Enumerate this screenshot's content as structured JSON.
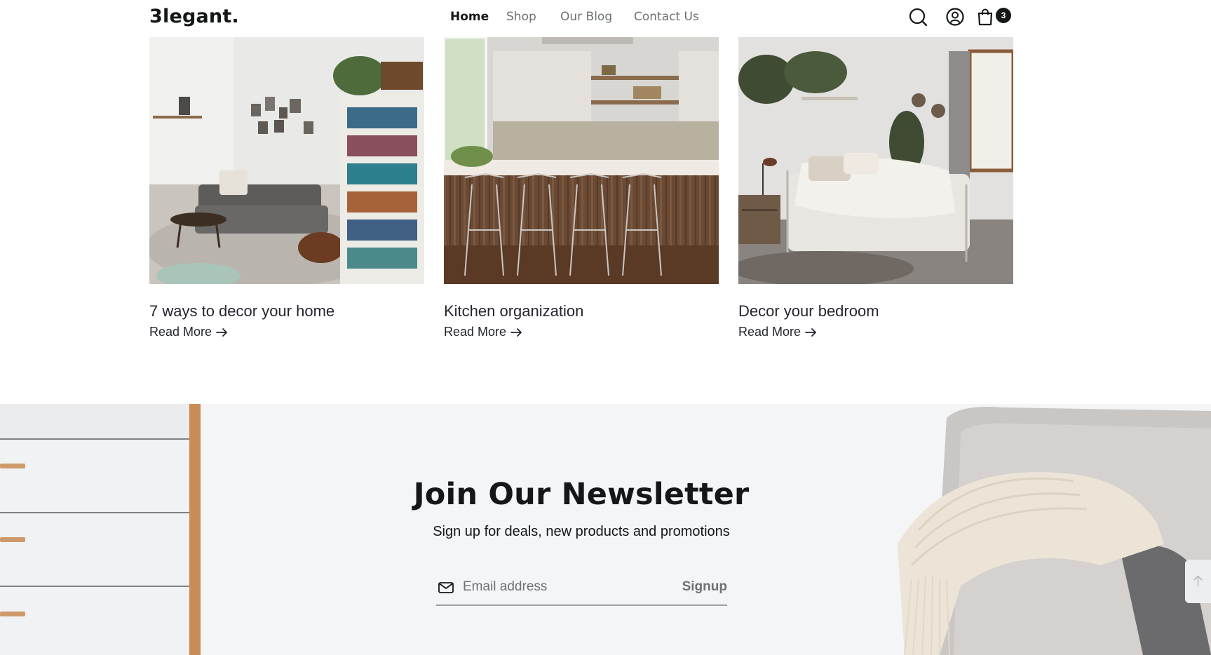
{
  "brand": {
    "logo": "3legant."
  },
  "nav": [
    {
      "label": "Home",
      "active": true
    },
    {
      "label": "Shop",
      "active": false
    },
    {
      "label": "Our Blog",
      "active": false
    },
    {
      "label": "Contact Us",
      "active": false
    }
  ],
  "header_icons": [
    "search-icon",
    "user-icon",
    "shopping-bag-icon"
  ],
  "cart": {
    "count": "3"
  },
  "blog": {
    "posts": [
      {
        "title": "7 ways to decor your home",
        "link_label": "Read More",
        "image": "living-room-photo"
      },
      {
        "title": "Kitchen organization",
        "link_label": "Read More",
        "image": "kitchen-photo"
      },
      {
        "title": "Decor your bedroom",
        "link_label": "Read More",
        "image": "bedroom-photo"
      }
    ]
  },
  "newsletter": {
    "title": "Join Our Newsletter",
    "subtitle": "Sign up for deals, new products and promotions",
    "email_placeholder": "Email address",
    "signup_label": "Signup"
  },
  "colors": {
    "text_primary": "#141718",
    "text_muted": "#6c7275",
    "newsletter_bg": "#f3f5f7",
    "badge_bg": "#141718"
  }
}
